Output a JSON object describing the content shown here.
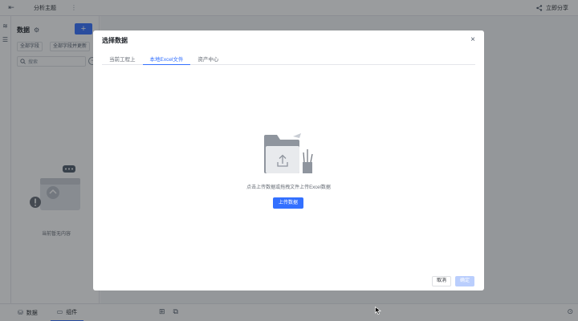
{
  "topbar": {
    "title": "分析主题",
    "more": "⋮",
    "share_label": "立即分享"
  },
  "panel": {
    "title": "数据",
    "add_label": "+",
    "chips": [
      "全部字段",
      "全部字段并更新"
    ],
    "search_placeholder": "搜索",
    "empty_text": "当前暂无内容"
  },
  "bottombar": {
    "tabs": [
      {
        "label": "数据",
        "active": false
      },
      {
        "label": "组件",
        "active": true
      }
    ]
  },
  "modal": {
    "title": "选择数据",
    "close_label": "×",
    "tabs": [
      {
        "label": "当前工程上",
        "active": false
      },
      {
        "label": "本地Excel文件",
        "active": true
      },
      {
        "label": "资产中心",
        "active": false
      }
    ],
    "upload_hint": "点击上传数据或拖拽文件上传Excel数据",
    "upload_button": "上传数据",
    "cancel_button": "取消",
    "ok_button": "确定"
  },
  "colors": {
    "accent": "#3370ff",
    "accent_disabled": "#bacefd",
    "mask": "rgba(31,35,41,0.45)"
  },
  "icons": [
    "exit-icon",
    "share-icon",
    "layers-icon",
    "list-icon",
    "gear-icon",
    "search-icon",
    "collapse-icon",
    "database-icon",
    "component-icon",
    "close-icon",
    "upload-icon",
    "expand-icon"
  ]
}
